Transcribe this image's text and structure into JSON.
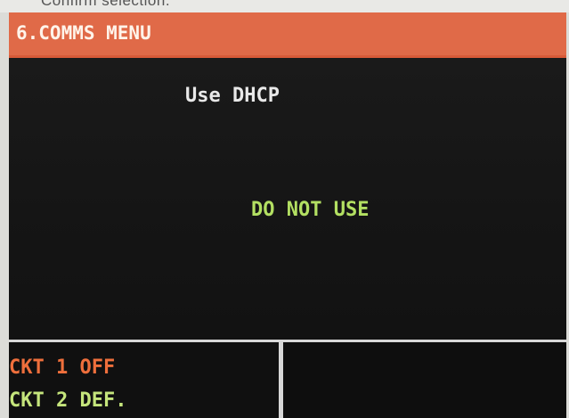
{
  "header_fragment": "Confirm selection.",
  "menu": {
    "title": "6.COMMS MENU"
  },
  "setting": {
    "label": "Use DHCP",
    "value": "DO NOT USE"
  },
  "circuits": [
    {
      "label": "CKT 1 OFF",
      "color": "#ef6f3c"
    },
    {
      "label": "CKT 2 DEF.",
      "color": "#c5e57c"
    }
  ],
  "colors": {
    "title_bar": "#e06a48",
    "screen_background": "#151515",
    "value_text": "#b3e062",
    "label_text": "#e8e8e8",
    "divider": "#d7d7d7"
  }
}
